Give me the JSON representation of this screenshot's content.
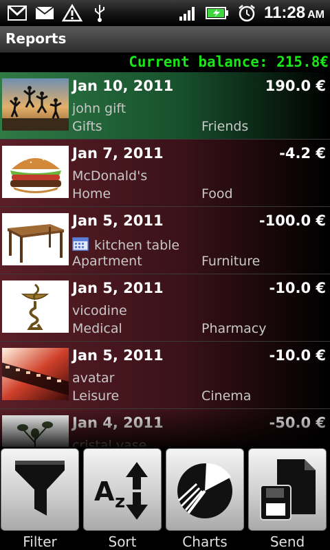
{
  "status_bar": {
    "time": "11:28",
    "ampm": "AM",
    "icons_left": [
      "gmail-icon",
      "mail-icon",
      "warning-icon",
      "usb-icon"
    ],
    "icons_right": [
      "signal-icon",
      "battery-charging-icon",
      "alarm-icon"
    ],
    "battery_color": "#3fd63f"
  },
  "title_bar": {
    "title": "Reports"
  },
  "balance": {
    "text": "Current balance: 215.8€",
    "color": "#19e619"
  },
  "transactions": [
    {
      "date": "Jan 10, 2011",
      "amount": "190.0 €",
      "description": "john gift",
      "category": "Gifts",
      "subcategory": "Friends",
      "thumbnail": "people-jumping-sunset",
      "type": "income"
    },
    {
      "date": "Jan 7, 2011",
      "amount": "-4.2 €",
      "description": "McDonald's",
      "category": "Home",
      "subcategory": "Food",
      "thumbnail": "hamburger",
      "type": "expense"
    },
    {
      "date": "Jan 5, 2011",
      "amount": "-100.0 €",
      "description": "kitchen table",
      "category": "Apartment",
      "subcategory": "Furniture",
      "thumbnail": "wooden-table",
      "type": "expense",
      "has_calendar_icon": true
    },
    {
      "date": "Jan 5, 2011",
      "amount": "-10.0 €",
      "description": "vicodine",
      "category": "Medical",
      "subcategory": "Pharmacy",
      "thumbnail": "pharmacy-snake-bowl",
      "type": "expense"
    },
    {
      "date": "Jan 5, 2011",
      "amount": "-10.0 €",
      "description": "avatar",
      "category": "Leisure",
      "subcategory": "Cinema",
      "thumbnail": "film-strip",
      "type": "expense"
    },
    {
      "date": "Jan 4, 2011",
      "amount": "-50.0 €",
      "description": "cristal vase",
      "category": "",
      "subcategory": "",
      "thumbnail": "flowers",
      "type": "expense"
    }
  ],
  "toolbar": {
    "filter_label": "Filter",
    "sort_label": "Sort",
    "charts_label": "Charts",
    "send_label": "Send"
  },
  "colors": {
    "income_row": "#2f7a45",
    "expense_row": "#5a1e27"
  }
}
